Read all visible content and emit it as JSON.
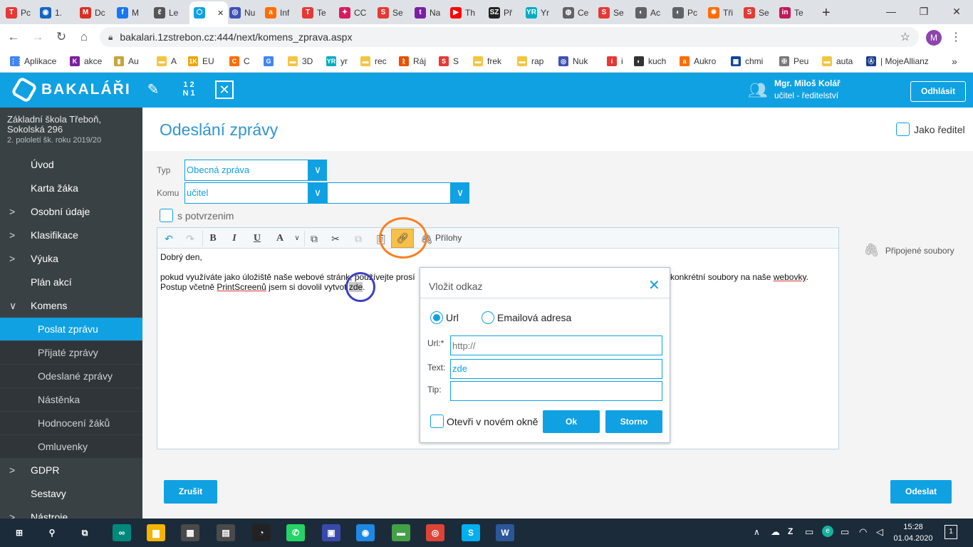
{
  "browser": {
    "tabs": [
      {
        "label": "Pc",
        "color": "#e53935",
        "glyph": "T"
      },
      {
        "label": "1.",
        "color": "#1565c0",
        "glyph": "◉"
      },
      {
        "label": "Dc",
        "color": "#d93025",
        "glyph": "M"
      },
      {
        "label": "M",
        "color": "#1877f2",
        "glyph": "f"
      },
      {
        "label": "Le",
        "color": "#555555",
        "glyph": "ℓ"
      },
      {
        "label": "",
        "color": "#10a1e3",
        "glyph": "⬡"
      },
      {
        "label": "Nu",
        "color": "#3f51b5",
        "glyph": "◎"
      },
      {
        "label": "Inf",
        "color": "#ff6d00",
        "glyph": "a"
      },
      {
        "label": "Te",
        "color": "#e53935",
        "glyph": "T"
      },
      {
        "label": "CC",
        "color": "#d81b60",
        "glyph": "✦"
      },
      {
        "label": "Se",
        "color": "#e53935",
        "glyph": "S"
      },
      {
        "label": "Na",
        "color": "#7b1fa2",
        "glyph": "t"
      },
      {
        "label": "Th",
        "color": "#ff0000",
        "glyph": "▶"
      },
      {
        "label": "Př",
        "color": "#222222",
        "glyph": "SZ"
      },
      {
        "label": "Yr",
        "color": "#00acc1",
        "glyph": "YR"
      },
      {
        "label": "Ce",
        "color": "#5f6368",
        "glyph": "◍"
      },
      {
        "label": "Se",
        "color": "#e53935",
        "glyph": "S"
      },
      {
        "label": "Ac",
        "color": "#5f6368",
        "glyph": "◐"
      },
      {
        "label": "Pc",
        "color": "#5f6368",
        "glyph": "◐"
      },
      {
        "label": "Tři",
        "color": "#ff6d00",
        "glyph": "✹"
      },
      {
        "label": "Se",
        "color": "#e53935",
        "glyph": "S"
      },
      {
        "label": "Te",
        "color": "#c2185b",
        "glyph": "in"
      }
    ],
    "new_tab": "+",
    "minimize": "—",
    "maximize": "❐",
    "close": "✕",
    "url": "bakalari.1zstrebon.cz:444/next/komens_zprava.aspx",
    "profile_initial": "M",
    "bookmarks": [
      {
        "label": "Aplikace",
        "color": "#4285f4",
        "glyph": "⋮⋮"
      },
      {
        "label": "akce",
        "color": "#7b1fa2",
        "glyph": "K"
      },
      {
        "label": "Au",
        "color": "#c8a53d",
        "glyph": "▮"
      },
      {
        "label": "A",
        "color": "#f4c542",
        "glyph": "▬"
      },
      {
        "label": "EU",
        "color": "#f4a300",
        "glyph": "1K"
      },
      {
        "label": "C",
        "color": "#ff6d00",
        "glyph": "C"
      },
      {
        "label": "",
        "color": "#4285f4",
        "glyph": "G"
      },
      {
        "label": "3D",
        "color": "#f4c542",
        "glyph": "▬"
      },
      {
        "label": "yr",
        "color": "#00acc1",
        "glyph": "YR"
      },
      {
        "label": "rec",
        "color": "#f4c542",
        "glyph": "▬"
      },
      {
        "label": "Ráj",
        "color": "#e65100",
        "glyph": "ᚱ"
      },
      {
        "label": "S",
        "color": "#e53935",
        "glyph": "S"
      },
      {
        "label": "frek",
        "color": "#f4c542",
        "glyph": "▬"
      },
      {
        "label": "rap",
        "color": "#f4c542",
        "glyph": "▬"
      },
      {
        "label": "Nuk",
        "color": "#3f51b5",
        "glyph": "◎"
      },
      {
        "label": "i",
        "color": "#e53935",
        "glyph": "i"
      },
      {
        "label": "kuch",
        "color": "#333333",
        "glyph": "◐"
      },
      {
        "label": "Aukro",
        "color": "#ff6d00",
        "glyph": "a"
      },
      {
        "label": "chmi",
        "color": "#0d47a1",
        "glyph": "▦"
      },
      {
        "label": "Peu",
        "color": "#777777",
        "glyph": "✠"
      },
      {
        "label": "auta",
        "color": "#f4c542",
        "glyph": "▬"
      },
      {
        "label": "| MojeAllianz",
        "color": "#1a3d8f",
        "glyph": "Ⓐ"
      }
    ],
    "bookmarks_more": "»"
  },
  "app": {
    "logo_text": "BAKALÁŘI",
    "user_name": "Mgr. Miloš Kolář",
    "user_role": "učitel - ředitelství",
    "logout_label": "Odhlásit",
    "header_icon_grade": "1\n2\nN1"
  },
  "sidebar": {
    "school_name": "Základní škola Třeboň, Sokolská 296",
    "school_term": "2. pololetí šk. roku 2019/20",
    "items": [
      {
        "label": "Úvod",
        "expandable": false,
        "expanded": false,
        "sub": false
      },
      {
        "label": "Karta žáka",
        "expandable": false,
        "expanded": false,
        "sub": false
      },
      {
        "label": "Osobní údaje",
        "expandable": true,
        "expanded": false,
        "sub": false
      },
      {
        "label": "Klasifikace",
        "expandable": true,
        "expanded": false,
        "sub": false
      },
      {
        "label": "Výuka",
        "expandable": true,
        "expanded": false,
        "sub": false
      },
      {
        "label": "Plán akcí",
        "expandable": false,
        "expanded": false,
        "sub": false
      },
      {
        "label": "Komens",
        "expandable": true,
        "expanded": true,
        "sub": false
      },
      {
        "label": "Poslat zprávu",
        "expandable": false,
        "expanded": false,
        "sub": true,
        "selected": true
      },
      {
        "label": "Přijaté zprávy",
        "expandable": false,
        "expanded": false,
        "sub": true
      },
      {
        "label": "Odeslané zprávy",
        "expandable": false,
        "expanded": false,
        "sub": true
      },
      {
        "label": "Nástěnka",
        "expandable": false,
        "expanded": false,
        "sub": true
      },
      {
        "label": "Hodnocení žáků",
        "expandable": false,
        "expanded": false,
        "sub": true
      },
      {
        "label": "Omluvenky",
        "expandable": false,
        "expanded": false,
        "sub": true
      },
      {
        "label": "GDPR",
        "expandable": true,
        "expanded": false,
        "sub": false
      },
      {
        "label": "Sestavy",
        "expandable": false,
        "expanded": false,
        "sub": false
      },
      {
        "label": "Nástroje",
        "expandable": true,
        "expanded": false,
        "sub": false
      }
    ]
  },
  "page": {
    "title": "Odeslání zprávy",
    "jako_reditel_label": "Jako ředitel",
    "typ_label": "Typ",
    "typ_value": "Obecná zpráva",
    "komu_label": "Komu",
    "komu_value": "učitel",
    "komu_value2": "",
    "potvrzeni_label": "s potvrzenim",
    "prilohy_label": "Přílohy",
    "attached_files_label": "Připojené soubory",
    "editor": {
      "line1": "Dobrý den,",
      "line2_a": "pokud využíváte jako úložiště naše webové stránk",
      "line2_b": ", používejte prosí",
      "line2_c": "a konkrétní soubory na naše ",
      "line2_link": "webovky",
      "line2_end": ".",
      "line3_a": "Postup včetně ",
      "line3_link": "PrintScreenů",
      "line3_b": " jsem si dovolil vytvo",
      "line3_c": "t ",
      "line3_sel": "zde",
      "line3_end": "."
    },
    "cancel_label": "Zrušit",
    "send_label": "Odeslat"
  },
  "dialog": {
    "title": "Vložit odkaz",
    "close": "✕",
    "radio_url": "Url",
    "radio_email": "Emailová adresa",
    "url_label": "Url:*",
    "url_placeholder": "http://",
    "text_label": "Text:",
    "text_value": "zde",
    "tip_label": "Tip:",
    "tip_value": "",
    "new_window_label": "Otevři v novém okně",
    "ok_label": "Ok",
    "cancel_label": "Storno"
  },
  "taskbar": {
    "time": "15:28",
    "date": "01.04.2020",
    "notification_count": "1",
    "apps": [
      {
        "name": "start",
        "glyph": "⊞",
        "color": "#1c2b3a"
      },
      {
        "name": "search",
        "glyph": "⚲",
        "color": "#1c2b3a"
      },
      {
        "name": "task-view",
        "glyph": "⧉",
        "color": "#1c2b3a"
      },
      {
        "name": "app-1",
        "glyph": "∞",
        "color": "#00897b"
      },
      {
        "name": "explorer",
        "glyph": "▆",
        "color": "#f4b400"
      },
      {
        "name": "store",
        "glyph": "▦",
        "color": "#4a4a4a"
      },
      {
        "name": "calculator",
        "glyph": "▤",
        "color": "#4a4a4a"
      },
      {
        "name": "speed",
        "glyph": "◔",
        "color": "#222222"
      },
      {
        "name": "whatsapp",
        "glyph": "✆",
        "color": "#25d366"
      },
      {
        "name": "app-2",
        "glyph": "▣",
        "color": "#3949ab"
      },
      {
        "name": "app-3",
        "glyph": "◉",
        "color": "#1e88e5"
      },
      {
        "name": "car",
        "glyph": "▬",
        "color": "#43a047"
      },
      {
        "name": "chrome",
        "glyph": "◎",
        "color": "#db4437"
      },
      {
        "name": "skype",
        "glyph": "S",
        "color": "#00aff0"
      },
      {
        "name": "word",
        "glyph": "W",
        "color": "#2b579a"
      }
    ]
  },
  "colors": {
    "accent": "#10a1e3",
    "sidebar": "#3a4145",
    "annotation_orange": "#ff7f1e",
    "annotation_blue": "#3b3fc4"
  }
}
